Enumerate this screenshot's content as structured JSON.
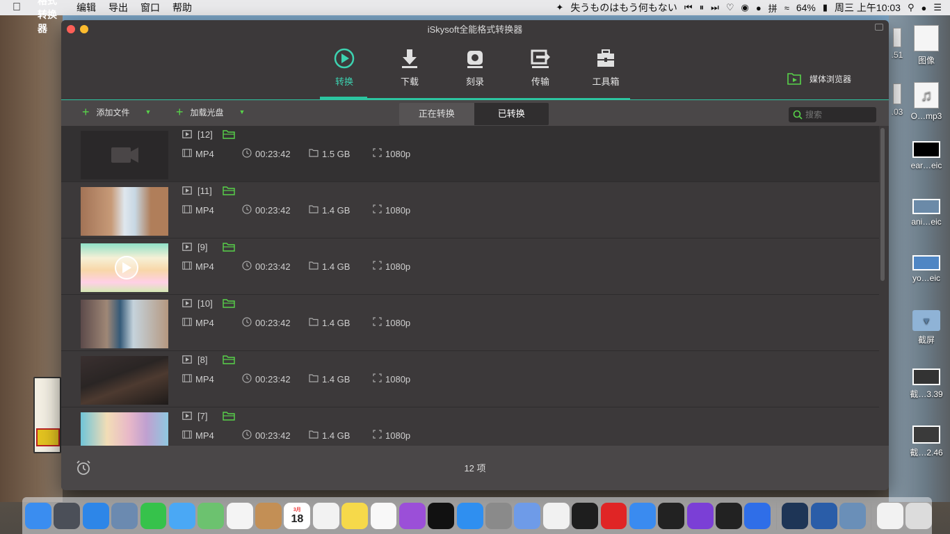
{
  "menubar": {
    "app_name": "全能格式转换器",
    "items": [
      "编辑",
      "导出",
      "窗口",
      "帮助"
    ],
    "now_playing": "失うものはもう何もない",
    "battery": "64%",
    "clock": "周三 上午10:03"
  },
  "window": {
    "title": "iSkysoft全能格式转换器",
    "tabs": [
      {
        "label": "转换",
        "icon": "convert-icon"
      },
      {
        "label": "下载",
        "icon": "download-icon"
      },
      {
        "label": "刻录",
        "icon": "burn-icon"
      },
      {
        "label": "传输",
        "icon": "transfer-icon"
      },
      {
        "label": "工具箱",
        "icon": "toolbox-icon"
      }
    ],
    "media_browser": "媒体浏览器",
    "add_file": "添加文件",
    "load_disc": "加载光盘",
    "segment": {
      "converting": "正在转换",
      "converted": "已转换"
    },
    "search_placeholder": "搜索",
    "footer_count": "12 项"
  },
  "files": [
    {
      "name": "[12]",
      "format": "MP4",
      "duration": "00:23:42",
      "size": "1.5 GB",
      "resolution": "1080p",
      "thumb": "placeholder"
    },
    {
      "name": "[11]",
      "format": "MP4",
      "duration": "00:23:42",
      "size": "1.4 GB",
      "resolution": "1080p",
      "thumb": "anime-girl-stairs"
    },
    {
      "name": "[9]",
      "format": "MP4",
      "duration": "00:23:42",
      "size": "1.4 GB",
      "resolution": "1080p",
      "thumb": "anime-blonde-girl"
    },
    {
      "name": "[10]",
      "format": "MP4",
      "duration": "00:23:42",
      "size": "1.4 GB",
      "resolution": "1080p",
      "thumb": "anime-boy-computer"
    },
    {
      "name": "[8]",
      "format": "MP4",
      "duration": "00:23:42",
      "size": "1.4 GB",
      "resolution": "1080p",
      "thumb": "dark-hallway"
    },
    {
      "name": "[7]",
      "format": "MP4",
      "duration": "00:23:42",
      "size": "1.4 GB",
      "resolution": "1080p",
      "thumb": "anime-group"
    }
  ],
  "desktop_icons": [
    {
      "label": ".51"
    },
    {
      "label": "图像"
    },
    {
      "label": ".03"
    },
    {
      "label": "O…mp3"
    },
    {
      "label": "ear…eic"
    },
    {
      "label": "ani…eic"
    },
    {
      "label": "yo…eic"
    },
    {
      "label": "截屏"
    },
    {
      "label": "截…3.39"
    },
    {
      "label": "截…2.46"
    }
  ],
  "dock": {
    "calendar_day": "18",
    "calendar_month": "3月",
    "apps": [
      "finder",
      "launchpad",
      "safari",
      "preview",
      "facetime",
      "messages",
      "maps",
      "photos",
      "contacts",
      "calendar",
      "reminders",
      "notes",
      "music",
      "podcasts",
      "tv",
      "app-store",
      "system-preferences",
      "migrator",
      "chrome",
      "qq",
      "netease-music",
      "baidu-netdisk",
      "infuse",
      "imovie",
      "final-cut",
      "wps",
      "quicktime",
      "quicktime-x",
      "image-capture",
      "mail",
      "trash"
    ]
  },
  "colors": {
    "accent": "#2cc5a0",
    "green": "#58d34a",
    "window_bg": "#3c393a"
  }
}
